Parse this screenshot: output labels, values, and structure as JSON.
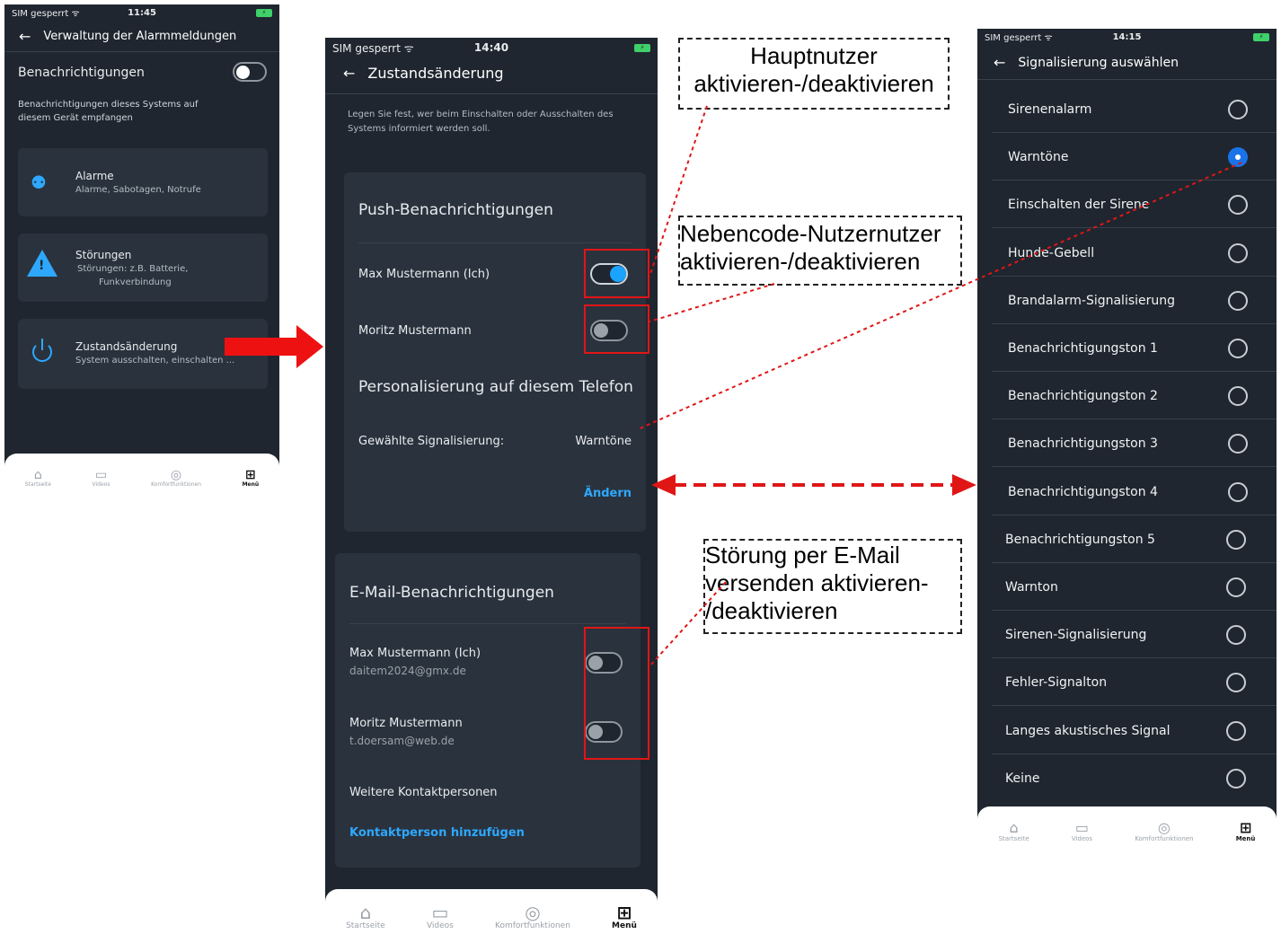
{
  "phone1": {
    "status": {
      "carrier": "SIM gesperrt ᯤ",
      "time": "11:45",
      "battery": "⚡"
    },
    "nav_title": "Verwaltung der Alarmmeldungen",
    "notifications_label": "Benachrichtigungen",
    "notifications_desc_1": "Benachrichtigungen dieses Systems auf",
    "notifications_desc_2": "diesem Gerät empfangen",
    "items": [
      {
        "title": "Alarme",
        "subtitle": "Alarme, Sabotagen, Notrufe"
      },
      {
        "title": "Störungen",
        "subtitle": "Störungen: z.B. Batterie,",
        "subtitle2": "Funkverbindung"
      },
      {
        "title": "Zustandsänderung",
        "subtitle": "System ausschalten, einschalten ..."
      }
    ],
    "tabs": [
      "Startseite",
      "Videos",
      "Komfortfunktionen",
      "Menü"
    ]
  },
  "phone2": {
    "status": {
      "carrier": "SIM gesperrt ᯤ",
      "time": "14:40",
      "battery": "⚡"
    },
    "nav_title": "Zustandsänderung",
    "intro_1": "Legen Sie fest, wer beim Einschalten oder Ausschalten des",
    "intro_2": "Systems informiert werden soll.",
    "push_header": "Push-Benachrichtigungen",
    "push_user_1": "Max Mustermann (Ich)",
    "push_user_2": "Moritz Mustermann",
    "personalization_header": "Personalisierung auf diesem Telefon",
    "signal_label": "Gewählte Signalisierung:",
    "signal_value": "Warntöne",
    "change_link": "Ändern",
    "email_header": "E-Mail-Benachrichtigungen",
    "email_user_1": "Max Mustermann (Ich)",
    "email_addr_1": "daitem2024@gmx.de",
    "email_user_2": "Moritz Mustermann",
    "email_addr_2": "t.doersam@web.de",
    "more_contacts": "Weitere Kontaktpersonen",
    "add_contact": "Kontaktperson hinzufügen",
    "tabs": [
      "Startseite",
      "Videos",
      "Komfortfunktionen",
      "Menü"
    ]
  },
  "phone3": {
    "status": {
      "carrier": "SIM gesperrt ᯤ",
      "time": "14:15",
      "battery": "⚡"
    },
    "nav_title": "Signalisierung auswählen",
    "options": [
      "Sirenenalarm",
      "Warntöne",
      "Einschalten der Sirene",
      "Hunde-Gebell",
      "Brandalarm-Signalisierung",
      "Benachrichtigungston 1",
      "Benachrichtigungston 2",
      "Benachrichtigungston 3",
      "Benachrichtigungston 4",
      "Benachrichtigungston 5",
      "Warnton",
      "Sirenen-Signalisierung",
      "Fehler-Signalton",
      "Langes akustisches Signal",
      "Keine"
    ],
    "selected": "Warntöne",
    "tabs": [
      "Startseite",
      "Videos",
      "Komfortfunktionen",
      "Menü"
    ]
  },
  "callouts": {
    "main_user_1": "Hauptnutzer",
    "main_user_2": "aktivieren-/deaktivieren",
    "sub_user_1": "Nebencode-Nutzernutzer",
    "sub_user_2": "aktivieren-/deaktivieren",
    "email_1": "Störung per E-Mail",
    "email_2": "versenden aktivieren-",
    "email_3": "/deaktivieren"
  },
  "toggles": {
    "push_user_1": true,
    "push_user_2": false,
    "email_user_1": false,
    "email_user_2": false,
    "phone1_notifications": false
  }
}
